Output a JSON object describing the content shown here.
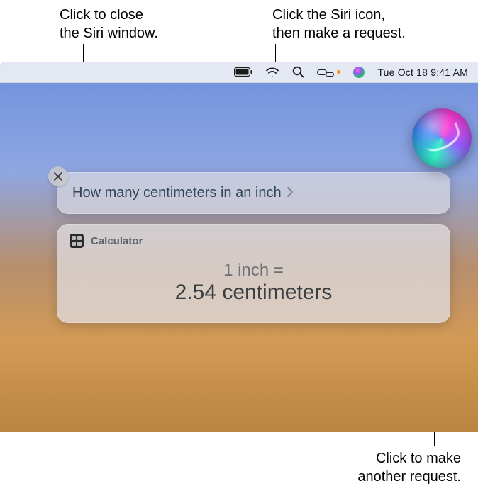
{
  "annotations": {
    "close": "Click to close\nthe Siri window.",
    "siri_menubar": "Click the Siri icon,\nthen make a request.",
    "orb": "Click to make\nanother request."
  },
  "menubar": {
    "date_time": "Tue Oct 18  9:41 AM"
  },
  "siri": {
    "query": "How many centimeters in an inch",
    "result": {
      "source": "Calculator",
      "line1": "1 inch =",
      "line2": "2.54 centimeters"
    }
  }
}
